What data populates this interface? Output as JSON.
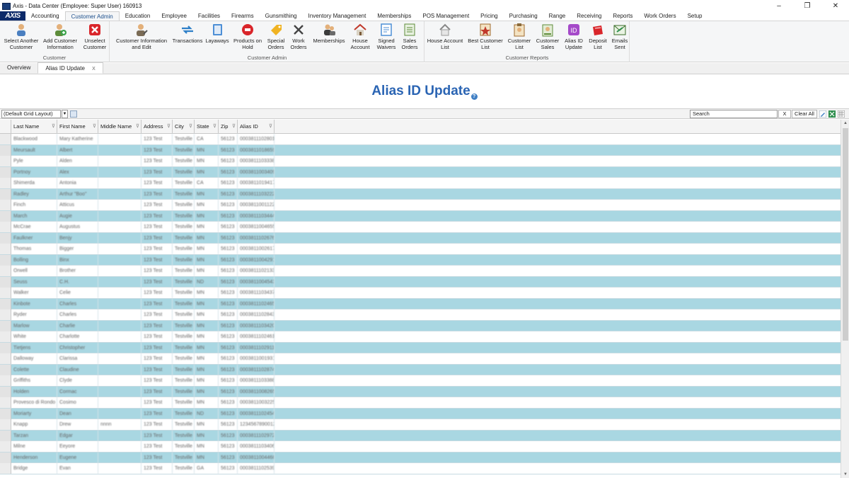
{
  "window": {
    "title": "Axis - Data Center  (Employee: Super User) 160913",
    "minimize": "–",
    "maximize": "❐",
    "close": "✕"
  },
  "menu": {
    "logo": "AXIS",
    "tabs": [
      "Accounting",
      "Customer Admin",
      "Education",
      "Employee",
      "Facilities",
      "Firearms",
      "Gunsmithing",
      "Inventory Management",
      "Memberships",
      "POS Management",
      "Pricing",
      "Purchasing",
      "Range",
      "Receiving",
      "Reports",
      "Work Orders",
      "Setup"
    ],
    "active": "Customer Admin"
  },
  "ribbon": {
    "groups": [
      {
        "label": "Customer",
        "buttons": [
          {
            "label": "Select Another\nCustomer",
            "icon": "person-icon"
          },
          {
            "label": "Add Customer\nInformation",
            "icon": "add-person-icon"
          },
          {
            "label": "Unselect\nCustomer",
            "icon": "red-x-icon"
          }
        ]
      },
      {
        "label": "Customer Admin",
        "buttons": [
          {
            "label": "Customer Information\nand Edit",
            "icon": "person-edit-icon"
          },
          {
            "label": "Transactions",
            "icon": "arrows-icon"
          },
          {
            "label": "Layaways",
            "icon": "notebook-icon"
          },
          {
            "label": "Products on\nHold",
            "icon": "hold-icon"
          },
          {
            "label": "Special\nOrders",
            "icon": "tag-icon"
          },
          {
            "label": "Work\nOrders",
            "icon": "tools-icon"
          },
          {
            "label": "Memberships",
            "icon": "members-icon"
          },
          {
            "label": "House\nAccount",
            "icon": "house-icon"
          },
          {
            "label": "Signed\nWaivers",
            "icon": "waiver-icon"
          },
          {
            "label": "Sales\nOrders",
            "icon": "sales-icon"
          }
        ]
      },
      {
        "label": "Customer Reports",
        "buttons": [
          {
            "label": "House Account\nList",
            "icon": "house-list-icon"
          },
          {
            "label": "Best Customer\nList",
            "icon": "star-list-icon"
          },
          {
            "label": "Customer\nList",
            "icon": "clipboard-icon"
          },
          {
            "label": "Customer\nSales",
            "icon": "customer-sales-icon"
          },
          {
            "label": "Alias ID\nUpdate",
            "icon": "id-icon"
          },
          {
            "label": "Deposit\nList",
            "icon": "deposit-icon"
          },
          {
            "label": "Emails\nSent",
            "icon": "email-icon"
          }
        ]
      }
    ]
  },
  "doctabs": [
    {
      "label": "Overview",
      "active": false
    },
    {
      "label": "Alias ID Update",
      "active": true,
      "close": "X"
    }
  ],
  "page": {
    "title": "Alias ID Update",
    "help": "?"
  },
  "toolbar": {
    "layout": "(Default Grid Layout)",
    "search_placeholder": "Search",
    "clear_x": "X",
    "clear_all": "Clear All"
  },
  "grid": {
    "columns": [
      "Last Name",
      "First Name",
      "Middle Name",
      "Address",
      "City",
      "State",
      "Zip",
      "Alias ID"
    ],
    "rows": [
      [
        "Blackwood",
        "Mary Katherine",
        "",
        "123 Test",
        "Testville",
        "CA",
        "56123",
        "0003811102801"
      ],
      [
        "Meursault",
        "Albert",
        "",
        "123 Test",
        "Testville",
        "MN",
        "56123",
        "0003811018659"
      ],
      [
        "Pyle",
        "Alden",
        "",
        "123 Test",
        "Testville",
        "MN",
        "56123",
        "0003811103338"
      ],
      [
        "Portnoy",
        "Alex",
        "",
        "123 Test",
        "Testville",
        "MN",
        "56123",
        "0003811003409"
      ],
      [
        "Shimerda",
        "Antonia",
        "",
        "123 Test",
        "Testville",
        "CA",
        "56123",
        "0003811019417"
      ],
      [
        "Radley",
        "Arthur \"Boo\"",
        "",
        "123 Test",
        "Testville",
        "MN",
        "56123",
        "0003811103222"
      ],
      [
        "Finch",
        "Atticus",
        "",
        "123 Test",
        "Testville",
        "MN",
        "56123",
        "0003811001122"
      ],
      [
        "March",
        "Augie",
        "",
        "123 Test",
        "Testville",
        "MN",
        "56123",
        "0003811103444"
      ],
      [
        "McCrae",
        "Augustus",
        "",
        "123 Test",
        "Testville",
        "MN",
        "56123",
        "0003811004655"
      ],
      [
        "Faulkner",
        "Benjy",
        "",
        "123 Test",
        "Testville",
        "MN",
        "56123",
        "0003811102676"
      ],
      [
        "Thomas",
        "Bigger",
        "",
        "123 Test",
        "Testville",
        "MN",
        "56123",
        "0003811002617"
      ],
      [
        "Bolling",
        "Binx",
        "",
        "123 Test",
        "Testville",
        "MN",
        "56123",
        "0003811004291"
      ],
      [
        "Orwell",
        "Brother",
        "",
        "123 Test",
        "Testville",
        "MN",
        "56123",
        "0003811102133"
      ],
      [
        "Seuss",
        "C.H.",
        "",
        "123 Test",
        "Testville",
        "ND",
        "56123",
        "0003811004543"
      ],
      [
        "Walker",
        "Celie",
        "",
        "123 Test",
        "Testville",
        "MN",
        "56123",
        "0003811103437"
      ],
      [
        "Kinbote",
        "Charles",
        "",
        "123 Test",
        "Testville",
        "MN",
        "56123",
        "0003811102465"
      ],
      [
        "Ryder",
        "Charles",
        "",
        "123 Test",
        "Testville",
        "MN",
        "56123",
        "0003811102843"
      ],
      [
        "Marlow",
        "Charlie",
        "",
        "123 Test",
        "Testville",
        "MN",
        "56123",
        "0003811103420"
      ],
      [
        "White",
        "Charlotte",
        "",
        "123 Test",
        "Testville",
        "MN",
        "56123",
        "0003811102461"
      ],
      [
        "Tietjens",
        "Christopher",
        "",
        "123 Test",
        "Testville",
        "MN",
        "56123",
        "0003811102911"
      ],
      [
        "Dalloway",
        "Clarissa",
        "",
        "123 Test",
        "Testville",
        "MN",
        "56123",
        "0003811001931"
      ],
      [
        "Colette",
        "Claudine",
        "",
        "123 Test",
        "Testville",
        "MN",
        "56123",
        "0003811102874"
      ],
      [
        "Griffiths",
        "Clyde",
        "",
        "123 Test",
        "Testville",
        "MN",
        "56123",
        "0003811103388"
      ],
      [
        "Holden",
        "Cormac",
        "",
        "123 Test",
        "Testville",
        "MN",
        "56123",
        "0003811008265"
      ],
      [
        "Provesco di Rondo",
        "Cosimo",
        "",
        "123 Test",
        "Testville",
        "MN",
        "56123",
        "0003811003225"
      ],
      [
        "Moriarty",
        "Dean",
        "",
        "123 Test",
        "Testville",
        "ND",
        "56123",
        "0003811102454"
      ],
      [
        "Knapp",
        "Drew",
        "nnnn",
        "123 Test",
        "Testville",
        "MN",
        "56123",
        "1234567890012"
      ],
      [
        "Tarzan",
        "Edgar",
        "",
        "123 Test",
        "Testville",
        "MN",
        "56123",
        "0003811102972"
      ],
      [
        "Milne",
        "Eeyore",
        "",
        "123 Test",
        "Testville",
        "MN",
        "56123",
        "0003811103406"
      ],
      [
        "Henderson",
        "Eugene",
        "",
        "123 Test",
        "Testville",
        "MN",
        "56123",
        "0003811004468"
      ],
      [
        "Bridge",
        "Evan",
        "",
        "123 Test",
        "Testville",
        "GA",
        "56123",
        "0003811102539"
      ]
    ]
  }
}
